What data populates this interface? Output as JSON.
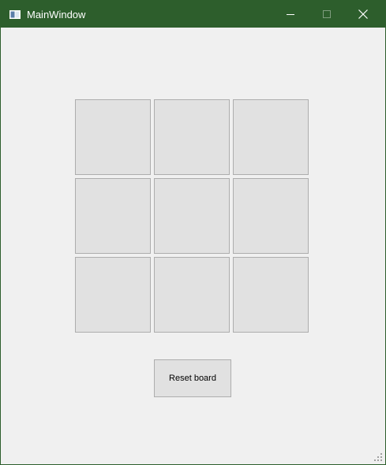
{
  "window": {
    "title": "MainWindow",
    "titlebar_color": "#2d5e2c",
    "background_color": "#f0f0f0"
  },
  "controls": {
    "minimize_icon": "minimize-icon",
    "maximize_icon": "maximize-icon",
    "close_icon": "close-icon"
  },
  "board": {
    "cells": [
      "",
      "",
      "",
      "",
      "",
      "",
      "",
      "",
      ""
    ],
    "cell_color": "#e1e1e1",
    "cell_border_color": "#adadad"
  },
  "reset_button": {
    "label": "Reset board"
  }
}
